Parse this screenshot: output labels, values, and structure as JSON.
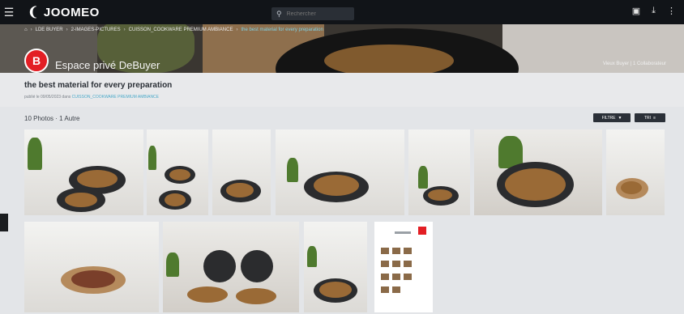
{
  "app": {
    "name": "JOOMEO"
  },
  "search": {
    "placeholder": "Rechercher"
  },
  "breadcrumb": [
    "LDE BUYER",
    "2-IMAGES-PICTURES",
    "CUISSON_COOKWARE PREMIUM AMBIANCE",
    "the best material for every preparation"
  ],
  "hero": {
    "title": "Espace privé DeBuyer",
    "right_text": "Vieux Buyer  |  1 Collaborateur"
  },
  "section": {
    "title": "the best material for every preparation",
    "published": "publié le 09/05/2023 dans",
    "published_tag": "CUISSON_COOKWARE PREMIUM AMBIANCE"
  },
  "count": "10 Photos · 1 Autre",
  "buttons": {
    "filter": "FILTRE",
    "sort": "TRI"
  },
  "icons": {
    "menu": "hamburger-icon",
    "search": "search-icon",
    "home": "home-icon",
    "monitor": "monitor-icon",
    "download": "download-icon",
    "more": "more-vertical-icon",
    "filter": "filter-icon",
    "sort": "sort-icon"
  }
}
